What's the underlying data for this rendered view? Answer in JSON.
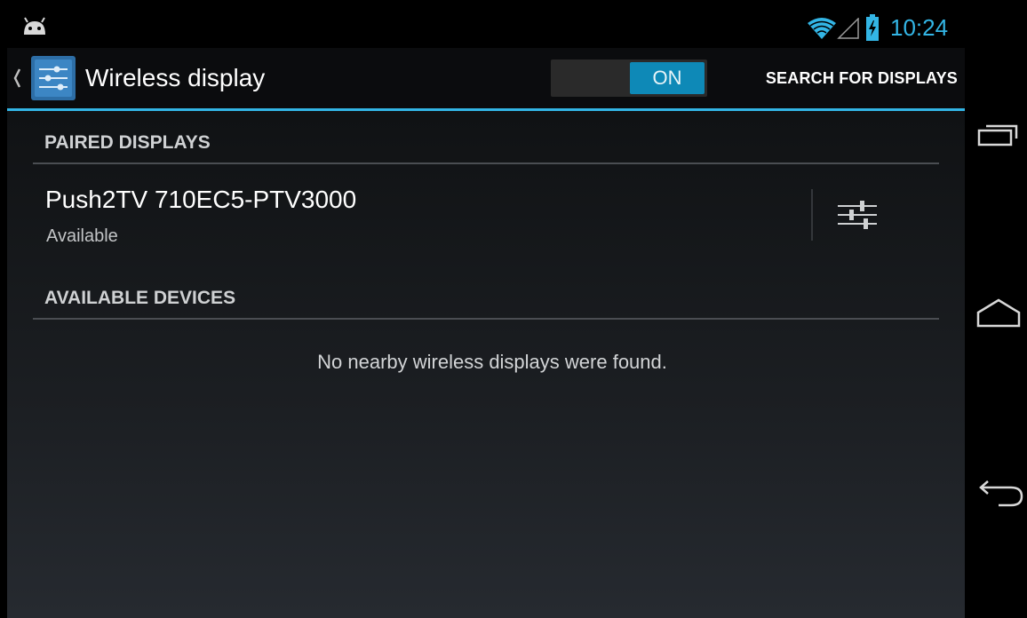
{
  "status_bar": {
    "time": "10:24",
    "icons": [
      "android-debug-icon",
      "wifi-icon",
      "signal-icon",
      "battery-charging-icon"
    ],
    "accent_color": "#33b5e5"
  },
  "action_bar": {
    "title": "Wireless display",
    "toggle_label": "ON",
    "search_button_label": "SEARCH FOR DISPLAYS",
    "app_icon": "settings-icon"
  },
  "sections": {
    "paired_header": "PAIRED DISPLAYS",
    "available_header": "AVAILABLE DEVICES"
  },
  "paired_device": {
    "name": "Push2TV 710EC5-PTV3000",
    "status": "Available",
    "settings_icon": "sliders-icon"
  },
  "available_empty_message": "No nearby wireless displays were found.",
  "nav_bar": {
    "icons": [
      "recent-apps-icon",
      "home-icon",
      "back-icon"
    ]
  }
}
